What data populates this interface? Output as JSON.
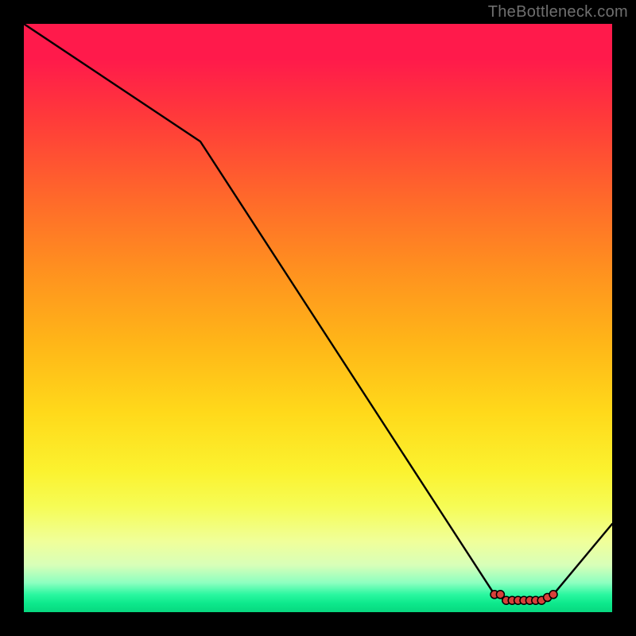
{
  "source_label": "TheBottleneck.com",
  "chart_data": {
    "type": "line",
    "title": "",
    "xlabel": "",
    "ylabel": "",
    "xlim": [
      0,
      100
    ],
    "ylim": [
      0,
      100
    ],
    "x": [
      0,
      30,
      80,
      82,
      85,
      88,
      90,
      100
    ],
    "values": [
      100,
      80,
      3,
      2,
      2,
      2,
      3,
      15
    ],
    "marker_x": [
      80,
      81,
      82,
      83,
      84,
      85,
      86,
      87,
      88,
      89,
      90
    ],
    "marker_values": [
      3,
      3,
      2,
      2,
      2,
      2,
      2,
      2,
      2,
      2.5,
      3
    ],
    "line_color": "#000000",
    "marker_color": "#d8403a",
    "marker_stroke": "#000000",
    "background": "gradient-red-yellow-green"
  }
}
